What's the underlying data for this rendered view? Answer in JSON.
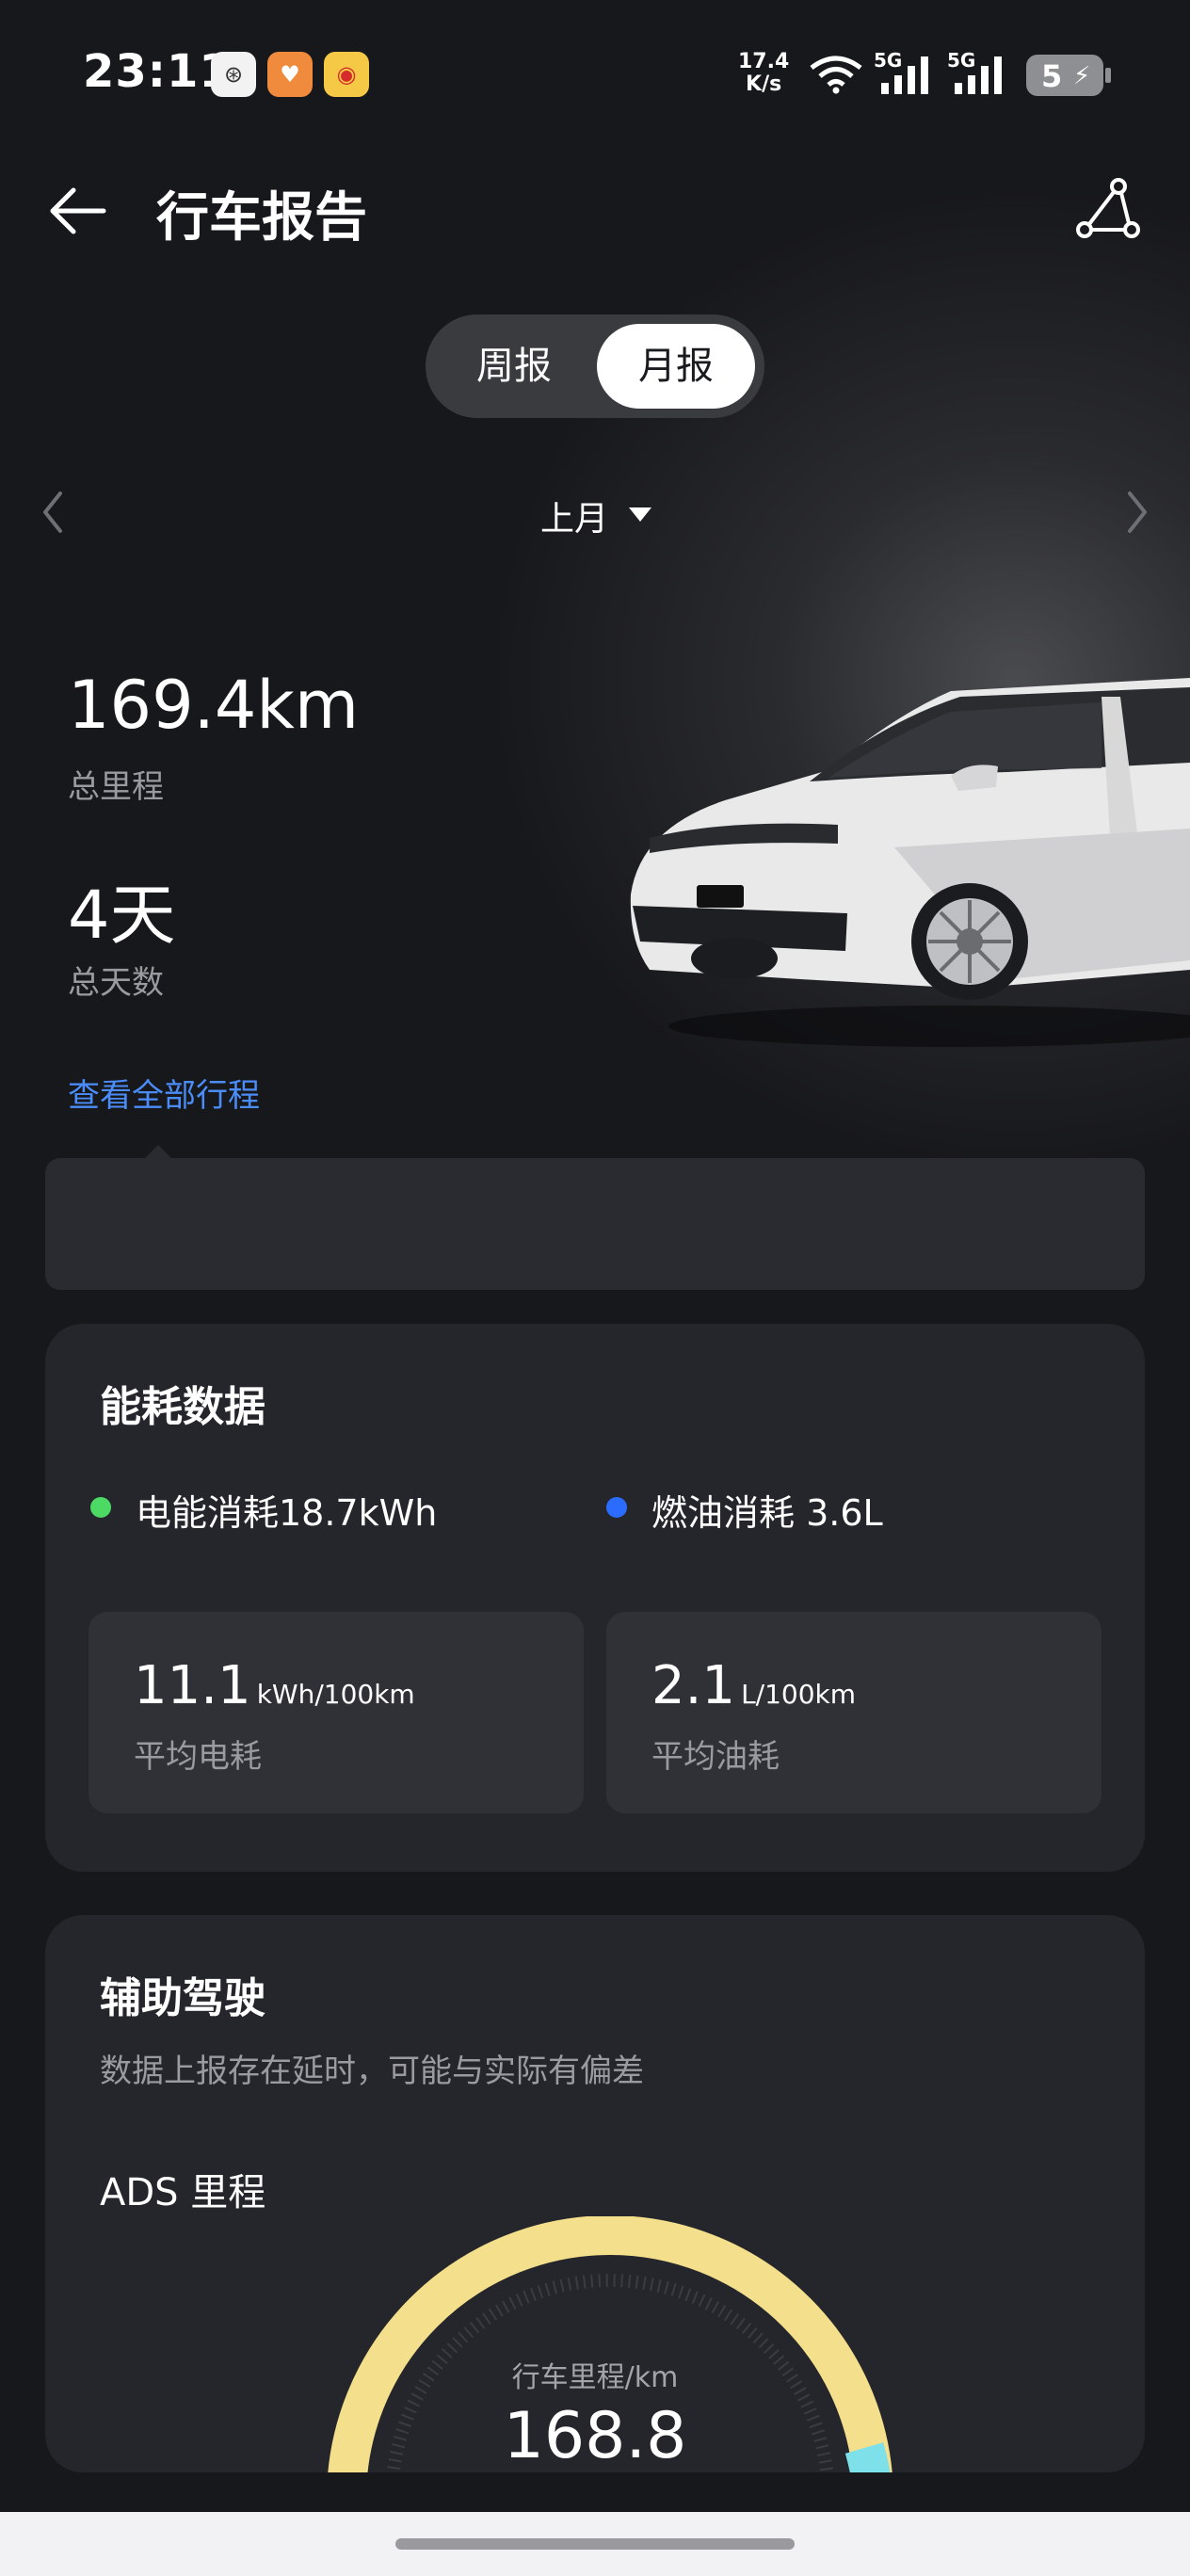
{
  "status_bar": {
    "time": "23:11",
    "net_speed_value": "17.4",
    "net_speed_unit": "K/s",
    "signal1_label": "5G",
    "signal2_label": "5G",
    "battery": "5",
    "icons": [
      "app-icon-1",
      "app-icon-2",
      "weibo-icon",
      "wifi-icon",
      "signal-icon",
      "signal-icon",
      "battery-icon"
    ]
  },
  "header": {
    "title": "行车报告",
    "back_icon": "back-arrow-icon",
    "share_icon": "share-icon"
  },
  "tabs": {
    "weekly": "周报",
    "monthly": "月报",
    "selected": "monthly"
  },
  "period": {
    "label": "上月"
  },
  "stats": {
    "total_distance": "169.4km",
    "total_distance_label": "总里程",
    "total_days": "4天",
    "total_days_label": "总天数",
    "view_all": "查看全部行程"
  },
  "energy": {
    "title": "能耗数据",
    "electric_legend": "电能消耗18.7kWh",
    "fuel_legend": "燃油消耗 3.6L",
    "electric_color": "#4cd964",
    "fuel_color": "#2b6cff",
    "avg_electric_value": "11.1",
    "avg_electric_unit": "kWh/100km",
    "avg_electric_label": "平均电耗",
    "avg_fuel_value": "2.1",
    "avg_fuel_unit": "L/100km",
    "avg_fuel_label": "平均油耗"
  },
  "ads": {
    "title": "辅助驾驶",
    "subtitle": "数据上报存在延时，可能与实际有偏差",
    "mileage_label": "ADS 里程",
    "gauge_label": "行车里程/km",
    "gauge_value": "168.8",
    "gauge_colors": [
      "#f3df8c",
      "#7ee0e8"
    ]
  },
  "colors": {
    "background": "#17181c",
    "card": "#25262b",
    "link": "#4b8df8"
  }
}
